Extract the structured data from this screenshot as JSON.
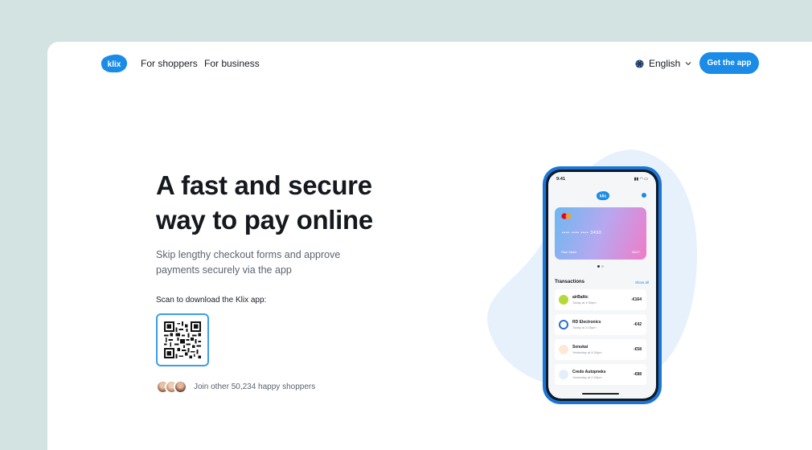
{
  "brand": {
    "name": "klix"
  },
  "nav": {
    "links": [
      "For shoppers",
      "For business"
    ],
    "language": "English",
    "cta": "Get the app"
  },
  "hero": {
    "headline_line1": "A fast and secure",
    "headline_line2": "way to pay online",
    "subtitle": "Skip lengthy checkout forms and approve payments securely via the app",
    "scan_label": "Scan to download the Klix app:",
    "social_proof": "Join other 50,234 happy shoppers"
  },
  "phone": {
    "time": "9:41",
    "card": {
      "number": "•••• •••• •••• 3490",
      "name": "Raul Mako",
      "expiry": "06/27"
    },
    "transactions_title": "Transactions",
    "show_all": "Show all",
    "transactions": [
      {
        "name": "airBaltic",
        "date": "Today at 4:30pm",
        "amount": "-€164"
      },
      {
        "name": "RD Electronics",
        "date": "Today at 3:25pm",
        "amount": "-€42"
      },
      {
        "name": "Senukai",
        "date": "Yesterday at 4:30pm",
        "amount": "-€58"
      },
      {
        "name": "Credo Autopneks",
        "date": "Yesterday at 2:30pm",
        "amount": "-€88"
      }
    ]
  },
  "colors": {
    "accent": "#1a8ce8",
    "background": "#d3e3e1",
    "blob": "#e6f1fc"
  }
}
